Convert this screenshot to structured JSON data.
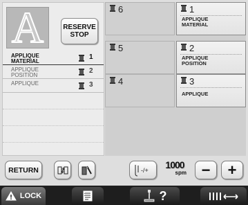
{
  "left_panel": {
    "preview_letter": "A",
    "reserve_stop": {
      "line1": "RESERVE",
      "line2": "STOP"
    },
    "color_list": [
      {
        "name_line1": "APPLIQUE",
        "name_line2": "MATERIAL",
        "number": "1",
        "state": "active"
      },
      {
        "name_line1": "APPLIQUE",
        "name_line2": "POSITION",
        "number": "2",
        "state": "dim"
      },
      {
        "name_line1": "APPLIQUE",
        "name_line2": "",
        "number": "3",
        "state": "dim"
      }
    ]
  },
  "needle_grid": [
    {
      "number": "6",
      "label_line1": "",
      "label_line2": "",
      "filled": false
    },
    {
      "number": "1",
      "label_line1": "APPLIQUE",
      "label_line2": "MATERIAL",
      "filled": true
    },
    {
      "number": "5",
      "label_line1": "",
      "label_line2": "",
      "filled": false
    },
    {
      "number": "2",
      "label_line1": "APPLIQUE",
      "label_line2": "POSITION",
      "filled": true
    },
    {
      "number": "4",
      "label_line1": "",
      "label_line2": "",
      "filled": false
    },
    {
      "number": "3",
      "label_line1": "APPLIQUE",
      "label_line2": "",
      "filled": true
    }
  ],
  "controls": {
    "return_label": "RETURN",
    "speed_value": "1000",
    "speed_unit": "spm",
    "minus_label": "−",
    "plus_label": "+"
  },
  "tabbar": {
    "lock_label": "LOCK",
    "help_label": "?"
  },
  "icons": {
    "move": "move-icon",
    "edit": "edit-icon",
    "tension": "thread-tension-icon",
    "lock": "warning-icon",
    "sheet": "sheet-icon",
    "help": "sewing-machine-icon",
    "thread": "thread-arrow-icon"
  }
}
